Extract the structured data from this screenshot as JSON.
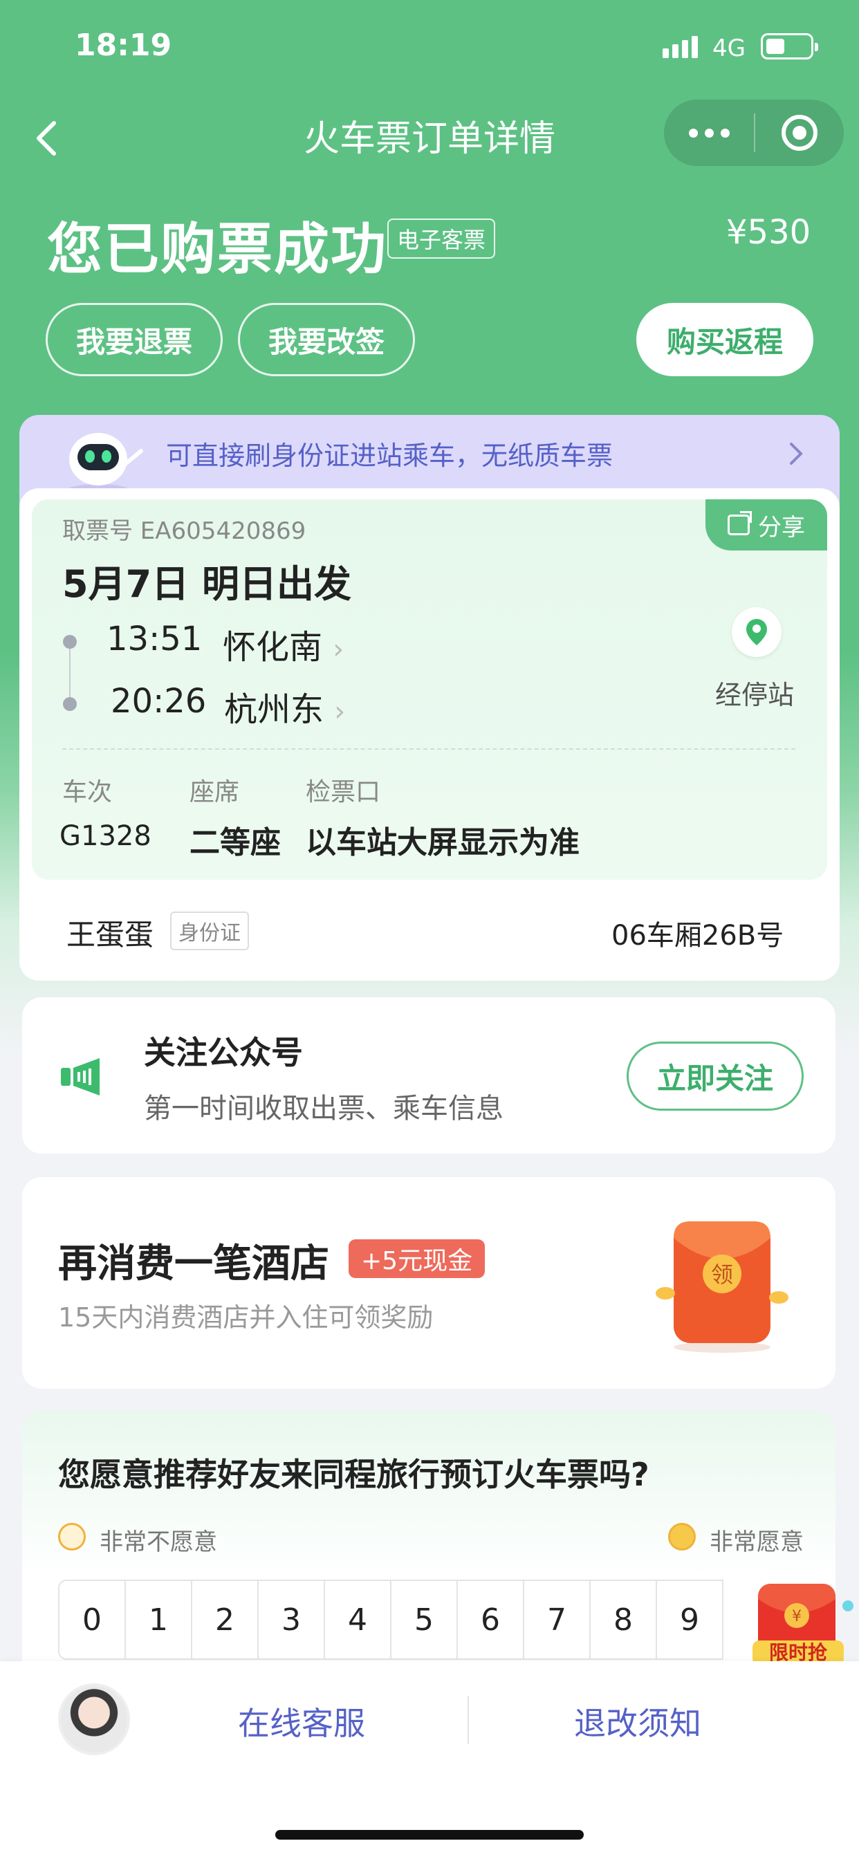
{
  "status_bar": {
    "time": "18:19",
    "network": "4G"
  },
  "nav": {
    "title": "火车票订单详情"
  },
  "header": {
    "status": "您已购票成功",
    "ticket_type": "电子客票",
    "price": "¥530",
    "actions": {
      "refund": "我要退票",
      "change": "我要改签",
      "return_trip": "购买返程"
    }
  },
  "banner": {
    "text": "可直接刷身份证进站乘车，无纸质车票"
  },
  "ticket": {
    "share": "分享",
    "pickup_no": "取票号 EA605420869",
    "date": "5月7日 明日出发",
    "departure": {
      "time": "13:51",
      "station": "怀化南"
    },
    "arrival": {
      "time": "20:26",
      "station": "杭州东"
    },
    "stops_label": "经停站",
    "labels": {
      "train": "车次",
      "seat_class": "座席",
      "gate": "检票口"
    },
    "values": {
      "train": "G1328",
      "seat_class": "二等座",
      "gate": "以车站大屏显示为准"
    },
    "passenger": {
      "name": "王蛋蛋",
      "id_type": "身份证",
      "seat": "06车厢26B号"
    }
  },
  "follow": {
    "title": "关注公众号",
    "subtitle": "第一时间收取出票、乘车信息",
    "button": "立即关注"
  },
  "hotel": {
    "title": "再消费一笔酒店",
    "tag": "+5元现金",
    "subtitle": "15天内消费酒店并入住可领奖励",
    "packet_char": "领"
  },
  "survey": {
    "question": "您愿意推荐好友来同程旅行预订火车票吗?",
    "low_label": "非常不愿意",
    "high_label": "非常愿意",
    "scale": [
      "0",
      "1",
      "2",
      "3",
      "4",
      "5",
      "6",
      "7",
      "8",
      "9"
    ]
  },
  "promo": {
    "label": "限时抢"
  },
  "bottom": {
    "service": "在线客服",
    "rules": "退改须知"
  },
  "colors": {
    "primary_green": "#5dc184",
    "link_blue": "#5561c7",
    "tag_red": "#ee6a5b",
    "banner_purple": "#ddd9fb"
  }
}
